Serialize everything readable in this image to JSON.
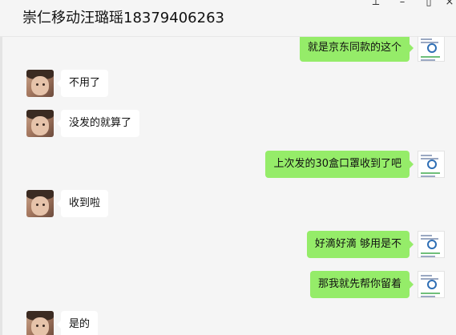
{
  "window": {
    "title": "崇仁移动汪璐瑶18379406263",
    "buttons": {
      "pin": "⟂",
      "minimize": "–",
      "maximize": "▯",
      "close": "×"
    }
  },
  "colors": {
    "outgoing_bubble": "#95ec69",
    "incoming_bubble": "#ffffff",
    "background": "#f5f5f5"
  },
  "messages": [
    {
      "side": "out",
      "text": "就是京东同款的这个"
    },
    {
      "side": "in",
      "text": "不用了"
    },
    {
      "side": "in",
      "text": "没发的就算了"
    },
    {
      "side": "out",
      "text": "上次发的30盒口罩收到了吧"
    },
    {
      "side": "in",
      "text": "收到啦"
    },
    {
      "side": "out",
      "text": "好滴好滴 够用是不"
    },
    {
      "side": "out",
      "text": "那我就先帮你留着"
    },
    {
      "side": "in",
      "text": "是的"
    }
  ]
}
